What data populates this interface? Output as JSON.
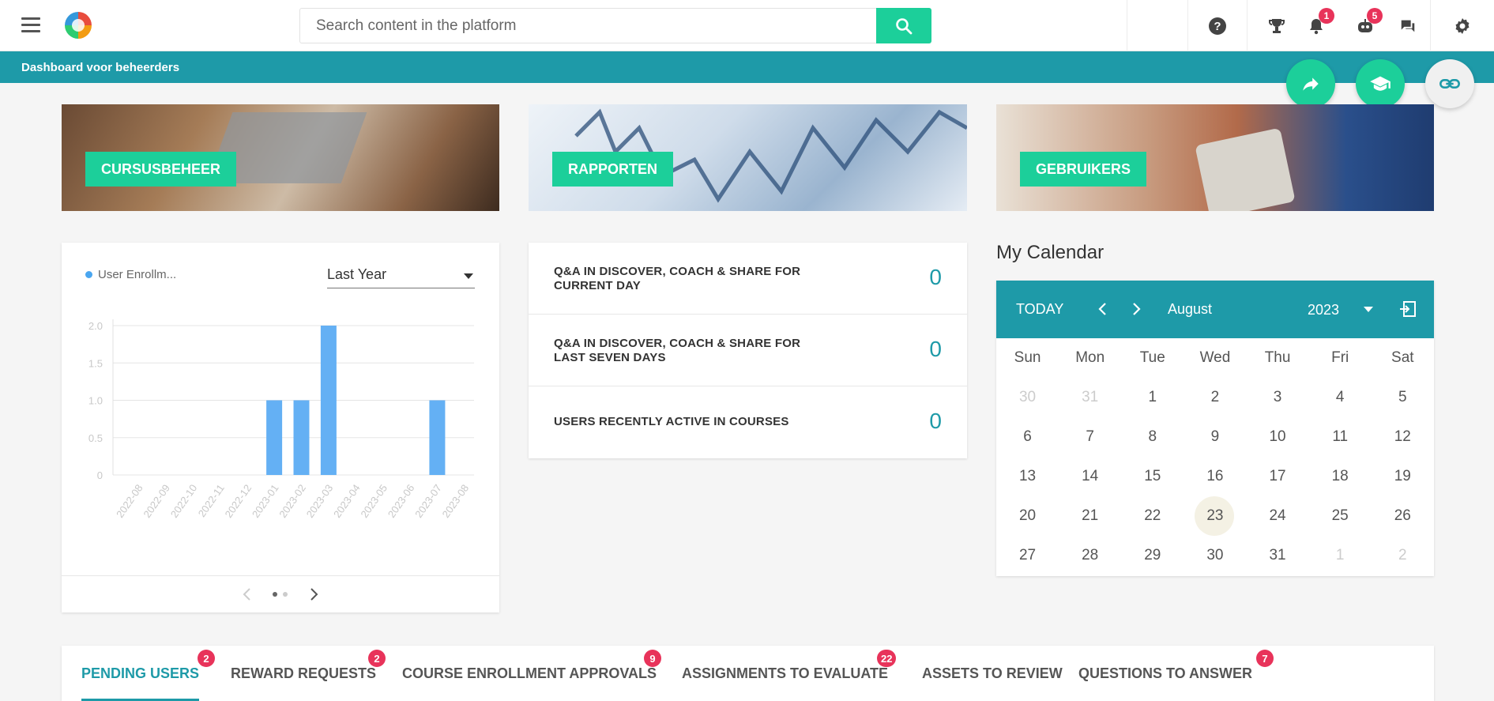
{
  "header": {
    "search_placeholder": "Search content in the platform",
    "notifications_count": "1",
    "messages_bot_count": "5"
  },
  "subbar": {
    "title": "Dashboard voor beheerders"
  },
  "banners": [
    {
      "label": "CURSUSBEHEER"
    },
    {
      "label": "RAPPORTEN"
    },
    {
      "label": "GEBRUIKERS"
    }
  ],
  "enrollment_card": {
    "legend": "User Enrollm...",
    "period": "Last Year"
  },
  "chart_data": {
    "type": "bar",
    "categories": [
      "2022-08",
      "2022-09",
      "2022-10",
      "2022-11",
      "2022-12",
      "2023-01",
      "2023-02",
      "2023-03",
      "2023-04",
      "2023-05",
      "2023-06",
      "2023-07",
      "2023-08"
    ],
    "series": [
      {
        "name": "User Enrollm...",
        "values": [
          0,
          0,
          0,
          0,
          0,
          1,
          1,
          2,
          0,
          0,
          0,
          1,
          0
        ]
      }
    ],
    "yticks": [
      "0",
      "0.5",
      "1.0",
      "1.5",
      "2.0"
    ],
    "ylim": [
      0,
      2
    ],
    "color": "#64b0f4"
  },
  "stats": [
    {
      "label": "Q&A IN DISCOVER, COACH & SHARE FOR CURRENT DAY",
      "value": "0"
    },
    {
      "label": "Q&A IN DISCOVER, COACH & SHARE FOR LAST SEVEN DAYS",
      "value": "0"
    },
    {
      "label": "USERS RECENTLY ACTIVE IN COURSES",
      "value": "0"
    }
  ],
  "calendar": {
    "title": "My Calendar",
    "today_label": "TODAY",
    "month": "August",
    "year": "2023",
    "days_of_week": [
      "Sun",
      "Mon",
      "Tue",
      "Wed",
      "Thu",
      "Fri",
      "Sat"
    ],
    "weeks": [
      [
        "30",
        "31",
        "1",
        "2",
        "3",
        "4",
        "5"
      ],
      [
        "6",
        "7",
        "8",
        "9",
        "10",
        "11",
        "12"
      ],
      [
        "13",
        "14",
        "15",
        "16",
        "17",
        "18",
        "19"
      ],
      [
        "20",
        "21",
        "22",
        "23",
        "24",
        "25",
        "26"
      ],
      [
        "27",
        "28",
        "29",
        "30",
        "31",
        "1",
        "2"
      ]
    ],
    "today": "23"
  },
  "tabs": [
    {
      "label": "PENDING USERS",
      "count": "2"
    },
    {
      "label": "REWARD REQUESTS",
      "count": "2"
    },
    {
      "label": "COURSE ENROLLMENT APPROVALS",
      "count": "9"
    },
    {
      "label": "ASSIGNMENTS TO EVALUATE",
      "count": "22"
    },
    {
      "label": "ASSETS TO REVIEW",
      "count": ""
    },
    {
      "label": "QUESTIONS TO ANSWER",
      "count": "7"
    }
  ]
}
